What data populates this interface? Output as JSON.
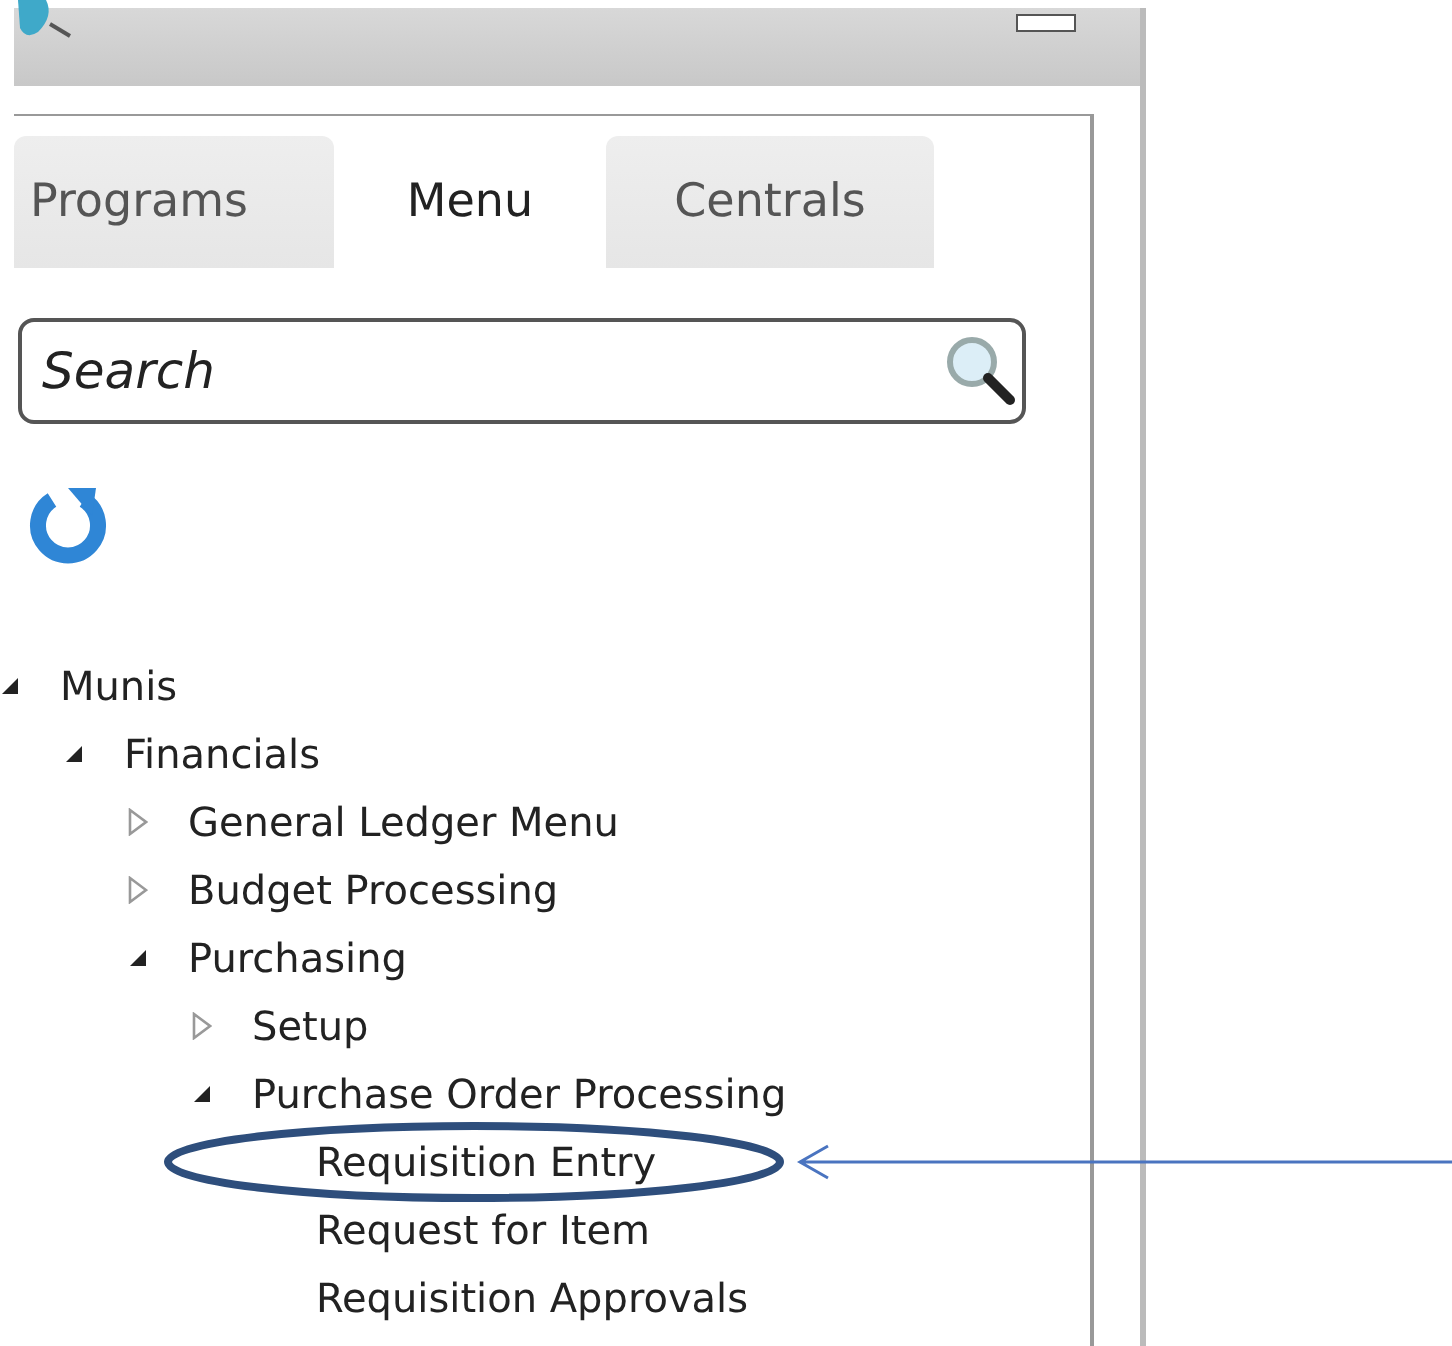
{
  "tabs": [
    {
      "label": "Programs",
      "selected": false
    },
    {
      "label": "Menu",
      "selected": true
    },
    {
      "label": "Centrals",
      "selected": false
    }
  ],
  "search": {
    "placeholder": "Search"
  },
  "tree": [
    {
      "label": "Munis",
      "kind": "folder",
      "expanded": true,
      "children": [
        {
          "label": "Financials",
          "kind": "folder",
          "expanded": true,
          "children": [
            {
              "label": "General Ledger Menu",
              "kind": "folder",
              "expanded": false
            },
            {
              "label": "Budget Processing",
              "kind": "folder",
              "expanded": false
            },
            {
              "label": "Purchasing",
              "kind": "folder",
              "expanded": true,
              "children": [
                {
                  "label": "Setup",
                  "kind": "folder",
                  "expanded": false
                },
                {
                  "label": "Purchase Order Processing",
                  "kind": "folder",
                  "expanded": true,
                  "children": [
                    {
                      "label": "Requisition Entry",
                      "kind": "item",
                      "highlighted": true
                    },
                    {
                      "label": "Request for Item",
                      "kind": "item",
                      "highlighted": false
                    },
                    {
                      "label": "Requisition Approvals",
                      "kind": "item",
                      "highlighted": false
                    }
                  ]
                }
              ]
            }
          ]
        }
      ]
    }
  ]
}
